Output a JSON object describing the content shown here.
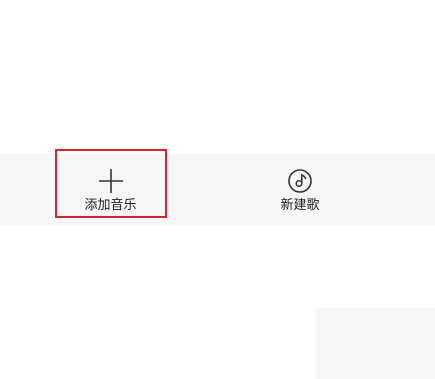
{
  "toolbar": {
    "add_music_label": "添加音乐",
    "new_playlist_label": "新建歌",
    "add_icon": "plus-icon",
    "playlist_icon": "music-disc-icon",
    "highlight_color": "#d8242c",
    "background_color": "#f6f6f6"
  }
}
